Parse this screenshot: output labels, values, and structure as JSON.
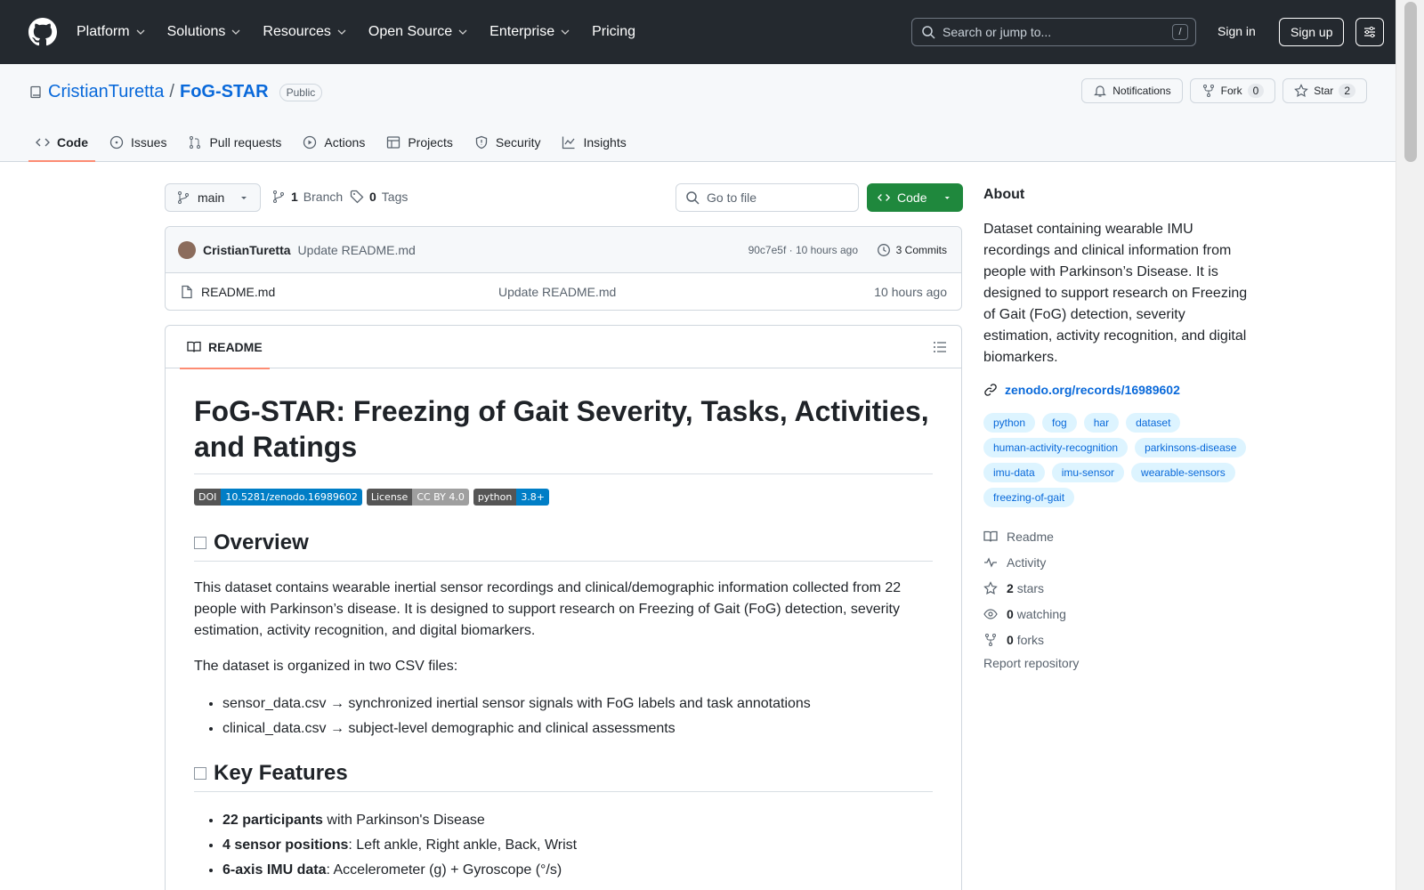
{
  "nav": {
    "items": [
      "Platform",
      "Solutions",
      "Resources",
      "Open Source",
      "Enterprise"
    ],
    "pricing": "Pricing",
    "search_placeholder": "Search or jump to...",
    "slash": "/",
    "signin": "Sign in",
    "signup": "Sign up"
  },
  "repo": {
    "owner": "CristianTuretta",
    "separator": "/",
    "name": "FoG-STAR",
    "visibility": "Public",
    "notifications": "Notifications",
    "fork": "Fork",
    "fork_count": "0",
    "star": "Star",
    "star_count": "2"
  },
  "tabs": [
    "Code",
    "Issues",
    "Pull requests",
    "Actions",
    "Projects",
    "Security",
    "Insights"
  ],
  "branchbar": {
    "branch": "main",
    "branches_count": "1",
    "branches_label": "Branch",
    "tags_count": "0",
    "tags_label": "Tags",
    "goto_placeholder": "Go to file",
    "code": "Code"
  },
  "commit": {
    "author": "CristianTuretta",
    "message": "Update README.md",
    "sha_time": "90c7e5f · 10 hours ago",
    "commits": "3 Commits"
  },
  "files": [
    {
      "name": "README.md",
      "message": "Update README.md",
      "date": "10 hours ago"
    }
  ],
  "readme": {
    "tab": "README",
    "title": "FoG-STAR: Freezing of Gait Severity, Tasks, Activities, and Ratings",
    "badges": [
      {
        "left": "DOI",
        "right": "10.5281/zenodo.16989602",
        "color": "#007ec6"
      },
      {
        "left": "License",
        "right": "CC BY 4.0",
        "color": "#9f9f9f"
      },
      {
        "left": "python",
        "right": "3.8+",
        "color": "#007ec6"
      }
    ],
    "overview_heading": "Overview",
    "overview_p1": "This dataset contains wearable inertial sensor recordings and clinical/demographic information collected from 22 people with Parkinson’s disease. It is designed to support research on Freezing of Gait (FoG) detection, severity estimation, activity recognition, and digital biomarkers.",
    "overview_p2": "The dataset is organized in two CSV files:",
    "files_list": [
      "sensor_data.csv → synchronized inertial sensor signals with FoG labels and task annotations",
      "clinical_data.csv → subject-level demographic and clinical assessments"
    ],
    "features_heading": "Key Features",
    "features": [
      {
        "bold": "22 participants",
        "rest": " with Parkinson's Disease"
      },
      {
        "bold": "4 sensor positions",
        "rest": ": Left ankle, Right ankle, Back, Wrist"
      },
      {
        "bold": "6-axis IMU data",
        "rest": ": Accelerometer (g) + Gyroscope (°/s)"
      }
    ]
  },
  "sidebar": {
    "about_title": "About",
    "about": "Dataset containing wearable IMU recordings and clinical information from people with Parkinson’s Disease. It is designed to support research on Freezing of Gait (FoG) detection, severity estimation, activity recognition, and digital biomarkers.",
    "link": "zenodo.org/records/16989602",
    "topics": [
      "python",
      "fog",
      "har",
      "dataset",
      "human-activity-recognition",
      "parkinsons-disease",
      "imu-data",
      "imu-sensor",
      "wearable-sensors",
      "freezing-of-gait"
    ],
    "readme": "Readme",
    "activity": "Activity",
    "stars_count": "2",
    "stars_label": "stars",
    "watching_count": "0",
    "watching_label": "watching",
    "forks_count": "0",
    "forks_label": "forks",
    "report": "Report repository"
  }
}
